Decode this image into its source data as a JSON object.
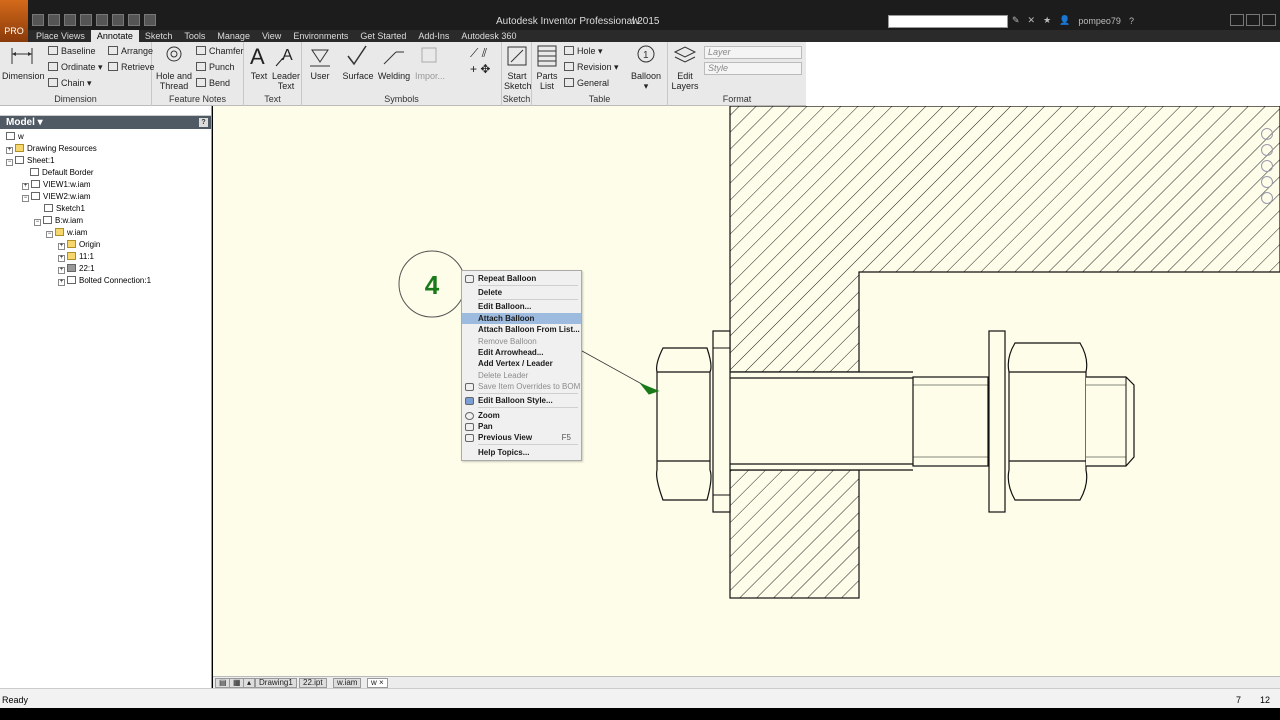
{
  "app": {
    "title": "Autodesk Inventor Professional 2015",
    "document_tab": "w",
    "logo_text": "PRO",
    "username": "pompeo79",
    "accent": "#d46a1a"
  },
  "ribbon_tabs": [
    "Place Views",
    "Annotate",
    "Sketch",
    "Tools",
    "Manage",
    "View",
    "Environments",
    "Get Started",
    "Add-Ins",
    "Autodesk 360"
  ],
  "active_tab": "Annotate",
  "ribbon": {
    "dimension_group": {
      "label": "Dimension",
      "dimension": "Dimension",
      "baseline": "Baseline",
      "ordinate": "Ordinate",
      "chain": "Chain",
      "arrange": "Arrange",
      "retrieve": "Retrieve"
    },
    "feature_notes_group": {
      "label": "Feature Notes",
      "hole_thread_1": "Hole and",
      "hole_thread_2": "Thread",
      "chamfer": "Chamfer",
      "punch": "Punch",
      "bend": "Bend"
    },
    "text_group": {
      "label": "Text",
      "text": "Text",
      "leader_text_1": "Leader",
      "leader_text_2": "Text"
    },
    "symbols_group": {
      "label": "Symbols",
      "user": "User",
      "surface": "Surface",
      "welding": "Welding",
      "import": "Impor..."
    },
    "sketch_group": {
      "label": "Sketch",
      "start_1": "Start",
      "start_2": "Sketch"
    },
    "table_group": {
      "label": "Table",
      "parts_1": "Parts",
      "parts_2": "List",
      "hole": "Hole",
      "revision": "Revision",
      "general": "General"
    },
    "balloon": {
      "label": "Balloon",
      "icon_text": "1"
    },
    "format_group": {
      "label": "Format",
      "edit_layers_1": "Edit",
      "edit_layers_2": "Layers",
      "layer_placeholder": "Layer",
      "style_placeholder": "Style"
    }
  },
  "browser": {
    "header": "Model",
    "help": "?",
    "items": [
      {
        "label": "w"
      },
      {
        "label": "Drawing Resources"
      },
      {
        "label": "Sheet:1"
      },
      {
        "label": "Default Border"
      },
      {
        "label": "VIEW1:w.iam"
      },
      {
        "label": "VIEW2:w.iam"
      },
      {
        "label": "Sketch1"
      },
      {
        "label": "B:w.iam"
      },
      {
        "label": "w.iam"
      },
      {
        "label": "Origin"
      },
      {
        "label": "11:1"
      },
      {
        "label": "22:1"
      },
      {
        "label": "Bolted Connection:1"
      }
    ]
  },
  "drawing": {
    "balloon_number": "4",
    "balloon_color": "#1a7a1a"
  },
  "context_menu": {
    "items": [
      {
        "label": "Repeat Balloon"
      },
      {
        "label": "Delete"
      },
      {
        "label": "Edit Balloon..."
      },
      {
        "label": "Attach Balloon"
      },
      {
        "label": "Attach Balloon From List..."
      },
      {
        "label": "Remove Balloon"
      },
      {
        "label": "Edit Arrowhead..."
      },
      {
        "label": "Add Vertex / Leader"
      },
      {
        "label": "Delete Leader"
      },
      {
        "label": "Save Item Overrides to BOM"
      },
      {
        "label": "Edit Balloon Style..."
      },
      {
        "label": "Zoom"
      },
      {
        "label": "Pan"
      },
      {
        "label": "Previous View",
        "shortcut": "F5"
      },
      {
        "label": "Help Topics..."
      }
    ],
    "highlighted": "Attach Balloon"
  },
  "doc_tabs": [
    "Drawing1",
    "22.ipt",
    "w.iam",
    "w"
  ],
  "status": {
    "text": "Ready",
    "n1": "7",
    "n2": "12"
  }
}
